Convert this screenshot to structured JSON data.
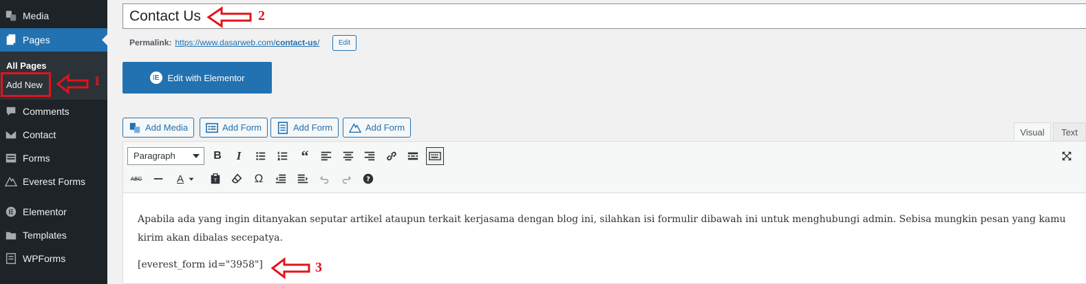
{
  "sidebar": {
    "items": [
      {
        "label": "Media",
        "icon": "media-icon"
      },
      {
        "label": "Pages",
        "icon": "pages-icon"
      },
      {
        "label": "Comments",
        "icon": "comments-icon"
      },
      {
        "label": "Contact",
        "icon": "envelope-icon"
      },
      {
        "label": "Forms",
        "icon": "forms-icon"
      },
      {
        "label": "Everest Forms",
        "icon": "everest-forms-icon"
      },
      {
        "label": "Elementor",
        "icon": "elementor-icon"
      },
      {
        "label": "Templates",
        "icon": "folder-icon"
      },
      {
        "label": "WPForms",
        "icon": "wpforms-icon"
      }
    ],
    "submenu": {
      "all_pages": "All Pages",
      "add_new": "Add New"
    }
  },
  "annotations": {
    "one": "1",
    "two": "2",
    "three": "3",
    "color": "#e3121b"
  },
  "title": {
    "value": "Contact Us"
  },
  "permalink": {
    "label": "Permalink:",
    "url_prefix": "https://www.dasarweb.com/",
    "slug": "contact-us",
    "url_suffix": "/",
    "edit_label": "Edit"
  },
  "elementor_button": {
    "label": "Edit with Elementor"
  },
  "media_buttons": [
    {
      "label": "Add Media",
      "icon": "add-media-icon"
    },
    {
      "label": "Add Form",
      "icon": "form-table-icon"
    },
    {
      "label": "Add Form",
      "icon": "form-list-icon"
    },
    {
      "label": "Add Form",
      "icon": "everest-form-icon"
    }
  ],
  "editor_tabs": {
    "visual": "Visual",
    "text": "Text"
  },
  "toolbar": {
    "format_select": "Paragraph",
    "row1": [
      "bold-icon",
      "italic-icon",
      "bullet-list-icon",
      "numbered-list-icon",
      "blockquote-icon",
      "align-left-icon",
      "align-center-icon",
      "align-right-icon",
      "link-icon",
      "read-more-icon",
      "toolbar-toggle-icon"
    ],
    "row2": [
      "strikethrough-icon",
      "horizontal-line-icon",
      "text-color-icon",
      "paste-text-icon",
      "clear-formatting-icon",
      "special-character-icon",
      "outdent-icon",
      "indent-icon",
      "undo-icon",
      "redo-icon",
      "help-icon"
    ]
  },
  "content": {
    "paragraph": "Apabila ada yang ingin ditanyakan seputar artikel ataupun terkait kerjasama dengan blog ini, silahkan isi formulir dibawah ini untuk menghubungi admin. Sebisa mungkin pesan yang kamu kirim akan dibalas secepatya.",
    "shortcode": "[everest_form id=\"3958\"]"
  },
  "colors": {
    "sidebar_bg": "#1d2327",
    "accent": "#2271b1",
    "page_bg": "#f1f1f1"
  }
}
